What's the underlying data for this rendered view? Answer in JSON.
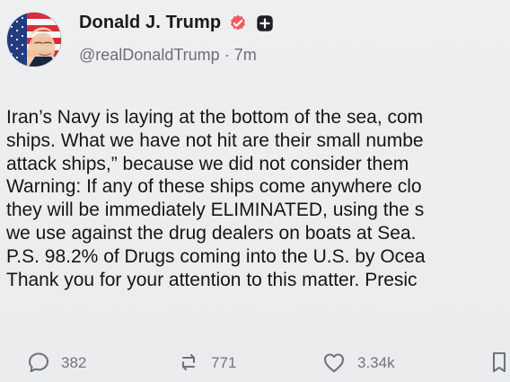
{
  "author": {
    "display_name": "Donald J. Trump",
    "handle": "@realDonaldTrump",
    "separator": "·",
    "time": "7m",
    "avatar_icon": "profile-avatar-flag-portrait-icon",
    "verified_icon": "verified-badge-icon",
    "plus_icon": "plus-badge-icon"
  },
  "post": {
    "lines": [
      "Iran’s Navy is laying at the bottom of the sea, com",
      "ships. What we have not hit are their small numbe",
      "attack ships,” because we did not consider them",
      "Warning: If any of these ships come anywhere clo",
      "they will be immediately ELIMINATED, using the s",
      "we use against the drug dealers on boats at Sea.",
      "P.S. 98.2% of Drugs coming into the U.S. by Ocea",
      "Thank you for your attention to this matter. Presic"
    ]
  },
  "actions": {
    "reply_count": "382",
    "repost_count": "771",
    "like_count": "3.34k",
    "reply_icon": "reply-icon",
    "repost_icon": "repost-icon",
    "like_icon": "heart-icon",
    "bookmark_icon": "bookmark-icon"
  },
  "colors": {
    "background": "#ecedef",
    "text": "#151515",
    "muted": "#6c6f75",
    "verified": "#ef5b5b",
    "plus_badge": "#1f2024"
  }
}
